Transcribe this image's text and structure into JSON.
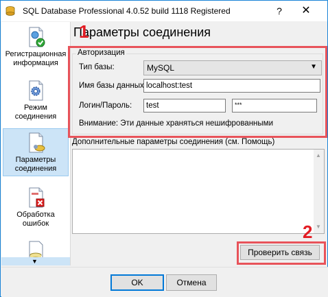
{
  "window": {
    "title": "SQL Database Professional 4.0.52 build 1118 Registered",
    "help_glyph": "?",
    "close_glyph": "✕"
  },
  "sidebar": {
    "items": [
      {
        "label": "Регистрационная информация",
        "icon": "certificate-check-icon",
        "active": false
      },
      {
        "label": "Режим соединения",
        "icon": "gear-document-icon",
        "active": false
      },
      {
        "label": "Параметры соединения",
        "icon": "document-settings-icon",
        "active": true
      },
      {
        "label": "Обработка ошибок",
        "icon": "error-document-icon",
        "active": false
      },
      {
        "label": "",
        "icon": "database-icon",
        "active": false
      }
    ],
    "scroll_glyph": "▼"
  },
  "main": {
    "heading": "Параметры соединения",
    "annotation_1": "1",
    "annotation_2": "2",
    "auth": {
      "legend": "Авторизация",
      "db_type_label": "Тип базы:",
      "db_type_value": "MySQL",
      "db_name_label": "Имя базы данных:",
      "db_name_value": "localhost:test",
      "login_label": "Логин/Пароль:",
      "login_value": "test",
      "password_value": "***",
      "warning": "Внимание: Эти данные храняться нешифрованными"
    },
    "advanced_label": "Дополнительные параметры соединения (см. Помощь)",
    "advanced_value": "",
    "test_button": "Проверить связь"
  },
  "footer": {
    "ok": "OK",
    "cancel": "Отмена"
  },
  "colors": {
    "annotation_red": "#e31c23",
    "selected_item_bg": "#cce4f7",
    "window_border": "#1883d7"
  }
}
